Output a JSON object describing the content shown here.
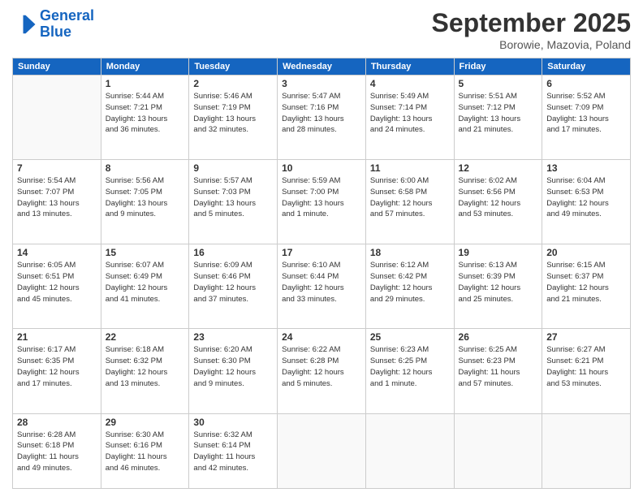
{
  "header": {
    "logo_line1": "General",
    "logo_line2": "Blue",
    "month_title": "September 2025",
    "subtitle": "Borowie, Mazovia, Poland"
  },
  "weekdays": [
    "Sunday",
    "Monday",
    "Tuesday",
    "Wednesday",
    "Thursday",
    "Friday",
    "Saturday"
  ],
  "weeks": [
    [
      {
        "day": "",
        "info": ""
      },
      {
        "day": "1",
        "info": "Sunrise: 5:44 AM\nSunset: 7:21 PM\nDaylight: 13 hours\nand 36 minutes."
      },
      {
        "day": "2",
        "info": "Sunrise: 5:46 AM\nSunset: 7:19 PM\nDaylight: 13 hours\nand 32 minutes."
      },
      {
        "day": "3",
        "info": "Sunrise: 5:47 AM\nSunset: 7:16 PM\nDaylight: 13 hours\nand 28 minutes."
      },
      {
        "day": "4",
        "info": "Sunrise: 5:49 AM\nSunset: 7:14 PM\nDaylight: 13 hours\nand 24 minutes."
      },
      {
        "day": "5",
        "info": "Sunrise: 5:51 AM\nSunset: 7:12 PM\nDaylight: 13 hours\nand 21 minutes."
      },
      {
        "day": "6",
        "info": "Sunrise: 5:52 AM\nSunset: 7:09 PM\nDaylight: 13 hours\nand 17 minutes."
      }
    ],
    [
      {
        "day": "7",
        "info": "Sunrise: 5:54 AM\nSunset: 7:07 PM\nDaylight: 13 hours\nand 13 minutes."
      },
      {
        "day": "8",
        "info": "Sunrise: 5:56 AM\nSunset: 7:05 PM\nDaylight: 13 hours\nand 9 minutes."
      },
      {
        "day": "9",
        "info": "Sunrise: 5:57 AM\nSunset: 7:03 PM\nDaylight: 13 hours\nand 5 minutes."
      },
      {
        "day": "10",
        "info": "Sunrise: 5:59 AM\nSunset: 7:00 PM\nDaylight: 13 hours\nand 1 minute."
      },
      {
        "day": "11",
        "info": "Sunrise: 6:00 AM\nSunset: 6:58 PM\nDaylight: 12 hours\nand 57 minutes."
      },
      {
        "day": "12",
        "info": "Sunrise: 6:02 AM\nSunset: 6:56 PM\nDaylight: 12 hours\nand 53 minutes."
      },
      {
        "day": "13",
        "info": "Sunrise: 6:04 AM\nSunset: 6:53 PM\nDaylight: 12 hours\nand 49 minutes."
      }
    ],
    [
      {
        "day": "14",
        "info": "Sunrise: 6:05 AM\nSunset: 6:51 PM\nDaylight: 12 hours\nand 45 minutes."
      },
      {
        "day": "15",
        "info": "Sunrise: 6:07 AM\nSunset: 6:49 PM\nDaylight: 12 hours\nand 41 minutes."
      },
      {
        "day": "16",
        "info": "Sunrise: 6:09 AM\nSunset: 6:46 PM\nDaylight: 12 hours\nand 37 minutes."
      },
      {
        "day": "17",
        "info": "Sunrise: 6:10 AM\nSunset: 6:44 PM\nDaylight: 12 hours\nand 33 minutes."
      },
      {
        "day": "18",
        "info": "Sunrise: 6:12 AM\nSunset: 6:42 PM\nDaylight: 12 hours\nand 29 minutes."
      },
      {
        "day": "19",
        "info": "Sunrise: 6:13 AM\nSunset: 6:39 PM\nDaylight: 12 hours\nand 25 minutes."
      },
      {
        "day": "20",
        "info": "Sunrise: 6:15 AM\nSunset: 6:37 PM\nDaylight: 12 hours\nand 21 minutes."
      }
    ],
    [
      {
        "day": "21",
        "info": "Sunrise: 6:17 AM\nSunset: 6:35 PM\nDaylight: 12 hours\nand 17 minutes."
      },
      {
        "day": "22",
        "info": "Sunrise: 6:18 AM\nSunset: 6:32 PM\nDaylight: 12 hours\nand 13 minutes."
      },
      {
        "day": "23",
        "info": "Sunrise: 6:20 AM\nSunset: 6:30 PM\nDaylight: 12 hours\nand 9 minutes."
      },
      {
        "day": "24",
        "info": "Sunrise: 6:22 AM\nSunset: 6:28 PM\nDaylight: 12 hours\nand 5 minutes."
      },
      {
        "day": "25",
        "info": "Sunrise: 6:23 AM\nSunset: 6:25 PM\nDaylight: 12 hours\nand 1 minute."
      },
      {
        "day": "26",
        "info": "Sunrise: 6:25 AM\nSunset: 6:23 PM\nDaylight: 11 hours\nand 57 minutes."
      },
      {
        "day": "27",
        "info": "Sunrise: 6:27 AM\nSunset: 6:21 PM\nDaylight: 11 hours\nand 53 minutes."
      }
    ],
    [
      {
        "day": "28",
        "info": "Sunrise: 6:28 AM\nSunset: 6:18 PM\nDaylight: 11 hours\nand 49 minutes."
      },
      {
        "day": "29",
        "info": "Sunrise: 6:30 AM\nSunset: 6:16 PM\nDaylight: 11 hours\nand 46 minutes."
      },
      {
        "day": "30",
        "info": "Sunrise: 6:32 AM\nSunset: 6:14 PM\nDaylight: 11 hours\nand 42 minutes."
      },
      {
        "day": "",
        "info": ""
      },
      {
        "day": "",
        "info": ""
      },
      {
        "day": "",
        "info": ""
      },
      {
        "day": "",
        "info": ""
      }
    ]
  ]
}
